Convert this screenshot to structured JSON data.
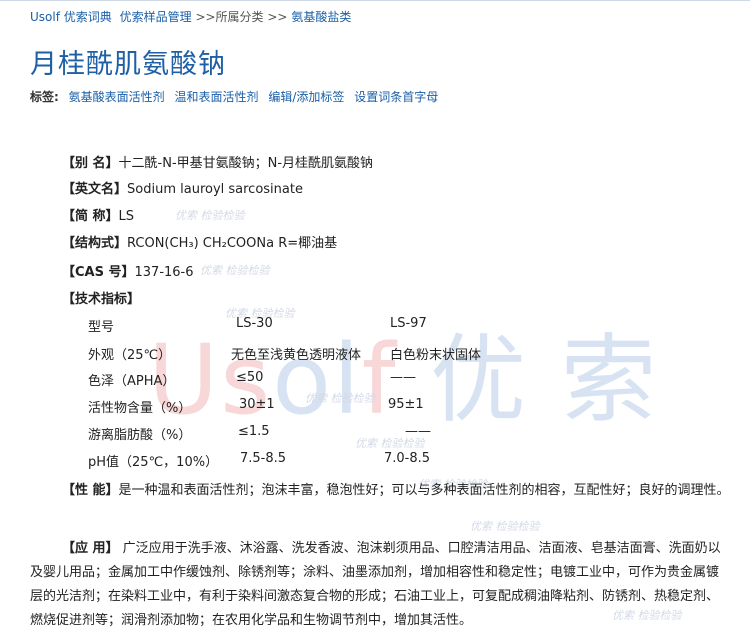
{
  "breadcrumb": {
    "site": "Usolf 优索词典",
    "manage": "优索样品管理",
    "sep1": " >>所属分类 ",
    "sep2": " >> ",
    "category": "氨基酸盐类"
  },
  "title": "月桂酰肌氨酸钠",
  "tags": {
    "label": "标签:",
    "items": [
      "氨基酸表面活性剂",
      "温和表面活性剂",
      "编辑/添加标签",
      "设置词条首字母"
    ]
  },
  "watermark": {
    "big": "Usolf 优 索",
    "small": "优索 检验检验"
  },
  "fields": {
    "alias": {
      "key": "【别  名】",
      "value": "十二酰-N-甲基甘氨酸钠；N-月桂酰肌氨酸钠"
    },
    "english": {
      "key": "【英文名】",
      "value": "Sodium lauroyl sarcosinate"
    },
    "abbr": {
      "key": "【简  称】",
      "value": "LS"
    },
    "formula": {
      "key": "【结构式】",
      "value": "RCON(CH₃) CH₂COONa R=椰油基"
    },
    "cas": {
      "key": "【CAS 号】",
      "value": "137-16-6"
    },
    "spec_title": "【技术指标】"
  },
  "spec_table": {
    "rows": [
      [
        "型号",
        "LS-30",
        "LS-97"
      ],
      [
        "外观（25℃）",
        "无色至浅黄色透明液体",
        "白色粉末状固体"
      ],
      [
        "色泽（APHA）",
        "≤50",
        "——"
      ],
      [
        "活性物含量（%）",
        "30±1",
        "95±1"
      ],
      [
        "游离脂肪酸（%）",
        "≤1.5",
        "——"
      ],
      [
        "pH值（25℃，10%）",
        "7.5-8.5",
        "7.0-8.5"
      ]
    ]
  },
  "performance": {
    "key": "【性  能】",
    "text": "是一种温和表面活性剂；泡沫丰富，稳泡性好；可以与多种表面活性剂的相容，互配性好；良好的调理性。"
  },
  "application": {
    "key": "【应  用】",
    "text": " 广泛应用于洗手液、沐浴露、洗发香波、泡沫剃须用品、口腔清洁用品、洁面液、皂基洁面膏、洗面奶以及婴儿用品；金属加工中作缓蚀剂、除锈剂等；涂料、油墨添加剂，增加相容性和稳定性；电镀工业中，可作为贵金属镀层的光洁剂；在染料工业中，有利于染料间激态复合物的形成；石油工业上，可复配成稠油降粘剂、防锈剂、热稳定剂、燃烧促进剂等；润滑剂添加物；在农用化学品和生物调节剂中，增加其活性。"
  }
}
